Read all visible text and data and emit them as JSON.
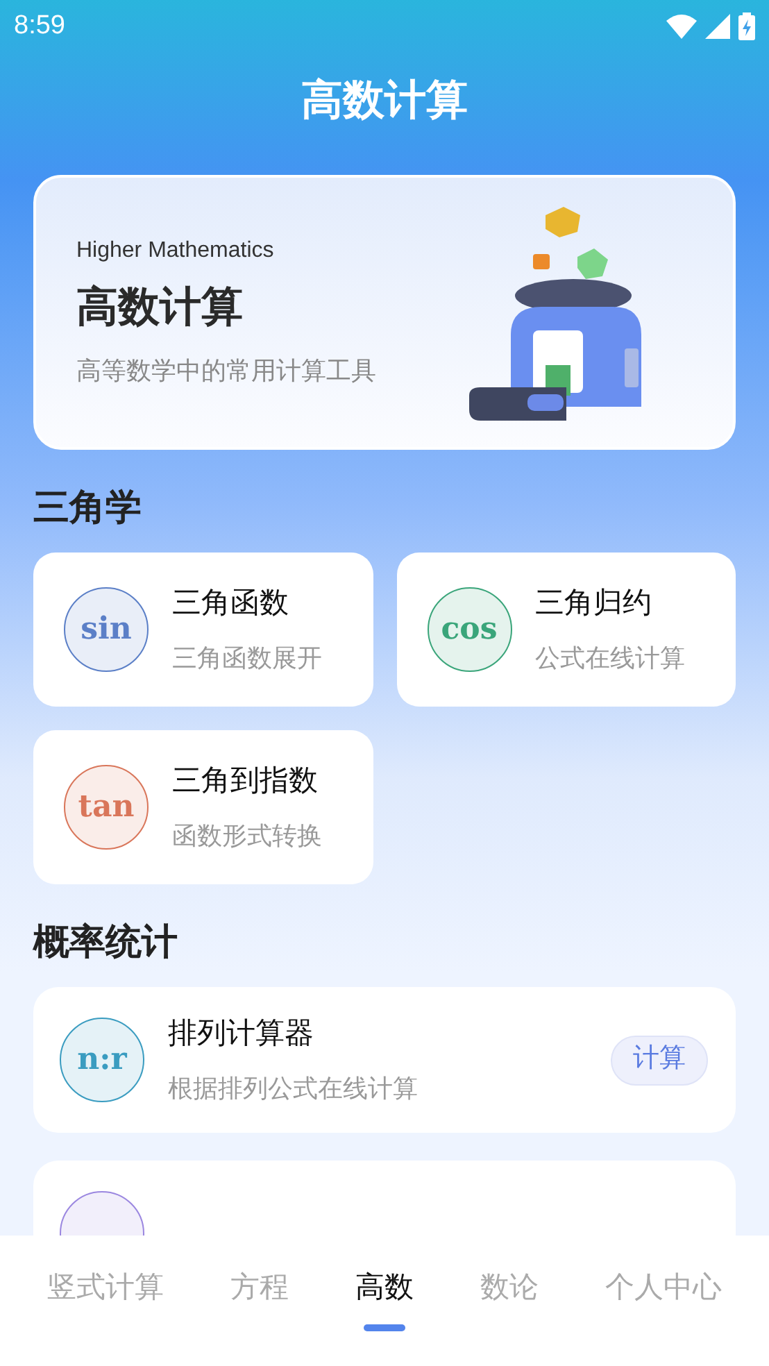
{
  "status_bar": {
    "time": "8:59"
  },
  "header": {
    "title": "高数计算"
  },
  "banner": {
    "subtitle_en": "Higher Mathematics",
    "title": "高数计算",
    "description": "高等数学中的常用计算工具"
  },
  "sections": [
    {
      "title": "三角学",
      "kind": "grid",
      "items": [
        {
          "badge": "sin",
          "color": "#5b7fc7",
          "title": "三角函数",
          "subtitle": "三角函数展开"
        },
        {
          "badge": "cos",
          "color": "#3aa57a",
          "title": "三角归约",
          "subtitle": "公式在线计算"
        },
        {
          "badge": "tan",
          "color": "#d9765a",
          "title": "三角到指数",
          "subtitle": "函数形式转换"
        }
      ]
    },
    {
      "title": "概率统计",
      "kind": "list",
      "items": [
        {
          "badge": "n:r",
          "color": "#3a9cc0",
          "title": "排列计算器",
          "subtitle": "根据排列公式在线计算",
          "action": "计算"
        },
        {
          "color": "#9b87e0"
        }
      ]
    }
  ],
  "tabs": [
    {
      "label": "竖式计算",
      "selected": false
    },
    {
      "label": "方程",
      "selected": false
    },
    {
      "label": "高数",
      "selected": true
    },
    {
      "label": "数论",
      "selected": false
    },
    {
      "label": "个人中心",
      "selected": false
    }
  ]
}
